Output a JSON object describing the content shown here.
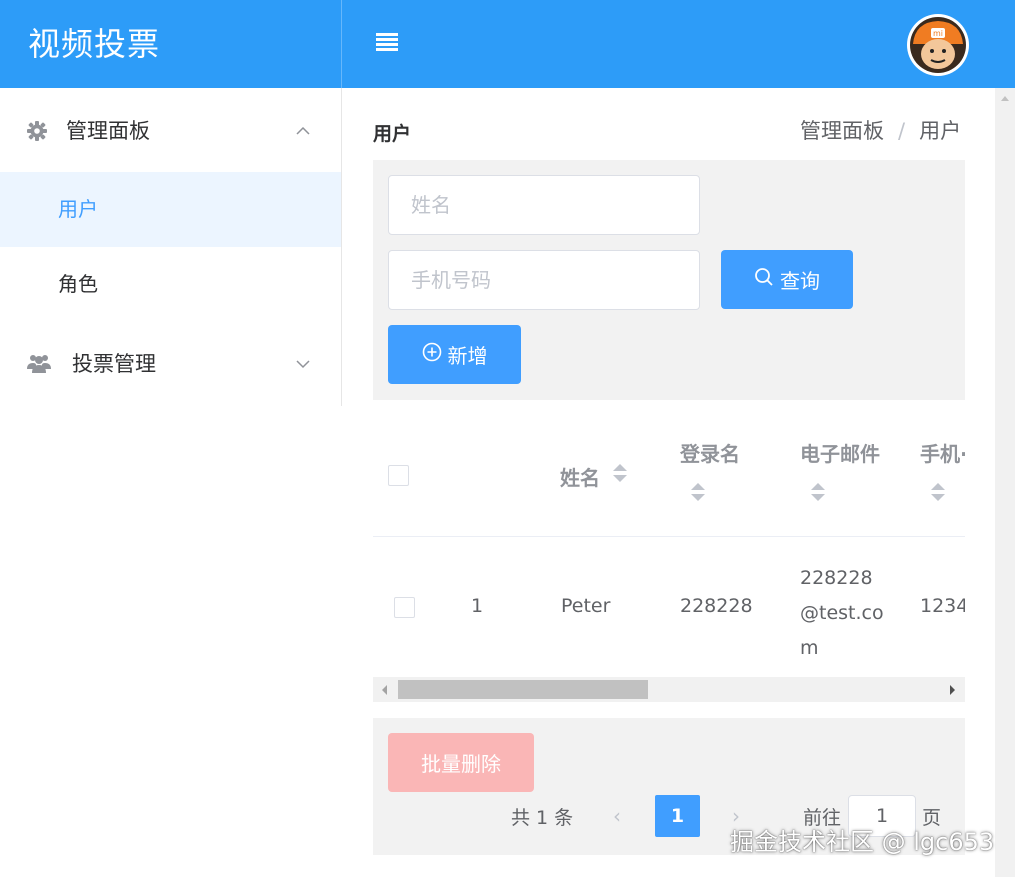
{
  "app": {
    "title": "视频投票"
  },
  "header": {
    "menu_icon": "menu-icon",
    "avatar_icon": "avatar-icon"
  },
  "sidebar": {
    "groups": [
      {
        "label": "管理面板",
        "icon": "gear-icon",
        "expanded": true,
        "items": [
          {
            "label": "用户",
            "active": true
          },
          {
            "label": "角色",
            "active": false
          }
        ]
      },
      {
        "label": "投票管理",
        "icon": "users-icon",
        "expanded": false,
        "items": []
      }
    ]
  },
  "main": {
    "title": "用户",
    "breadcrumb": [
      "管理面板",
      "用户"
    ],
    "search": {
      "name_placeholder": "姓名",
      "name_value": "",
      "phone_placeholder": "手机号码",
      "phone_value": "",
      "query_label": "查询",
      "add_label": "新增"
    },
    "table": {
      "columns": [
        "姓名",
        "登录名",
        "电子邮件",
        "手机·"
      ],
      "rows": [
        {
          "index": "1",
          "name": "Peter",
          "login": "228228",
          "email_lines": [
            "228228",
            "@test.co",
            "m"
          ],
          "phone": "1234"
        }
      ]
    },
    "batch_delete_label": "批量删除",
    "pagination": {
      "total": "共 1 条",
      "prev": "‹",
      "current": "1",
      "next": "›",
      "goto": "前往",
      "goto_value": "1",
      "page": "页"
    }
  },
  "watermark": "掘金技术社区 @ lgc653",
  "colors": {
    "header": "#2d9cf8",
    "primary": "#409eff",
    "danger_disabled": "#fab6b6",
    "active_bg": "#ecf5ff"
  }
}
